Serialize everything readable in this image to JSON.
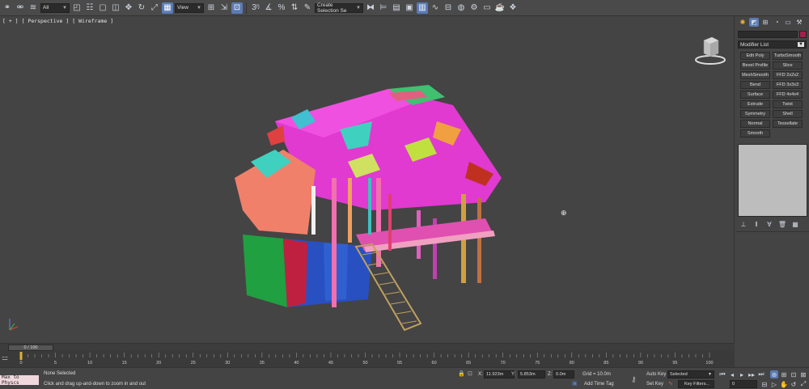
{
  "toolbar": {
    "selection_filter": "All",
    "ref_coord": "View",
    "named_selection": "Create Selection Se",
    "icons": [
      "link-icon",
      "unlink-icon",
      "bind-warp-icon",
      "select-filter",
      "select-object-icon",
      "select-by-name-icon",
      "rect-selection-icon",
      "window-crossing-icon",
      "move-icon",
      "rotate-icon",
      "scale-icon",
      "ref-coord",
      "pivot-icon",
      "mirror-icon",
      "align-icon",
      "snap-icon",
      "angle-snap-icon",
      "percent-snap-icon",
      "spinner-snap-icon",
      "edit-named-sel-icon",
      "named-selection",
      "mirror-icon",
      "align-icon",
      "layer-icon",
      "curve-editor-icon",
      "schematic-icon",
      "material-editor-icon",
      "render-setup-icon",
      "render-frame-icon",
      "render-icon"
    ]
  },
  "viewport": {
    "label_plus": "[ + ]",
    "label_view": "[ Perspective ]",
    "label_shading": "[ Wireframe ]"
  },
  "command_panel": {
    "modifier_list_label": "Modifier List",
    "object_color": "#a0204a",
    "modifiers": [
      "Edit Poly",
      "TurboSmooth",
      "Bevel Profile",
      "Slice",
      "MeshSmooth",
      "FFD 2x2x2",
      "Bend",
      "FFD 3x3x3",
      "Surface",
      "FFD 4x4x4",
      "Extrude",
      "Twist",
      "Symmetry",
      "Shell",
      "Normal",
      "Tessellate",
      "Smooth"
    ]
  },
  "timeline": {
    "frame_counter": "0 / 100",
    "ticks": [
      "0",
      "5",
      "10",
      "15",
      "20",
      "25",
      "30",
      "35",
      "40",
      "45",
      "50",
      "55",
      "60",
      "65",
      "70",
      "75",
      "80",
      "85",
      "90",
      "95",
      "100"
    ]
  },
  "status": {
    "maxscript_text": "Max to Physcs",
    "selection_status": "None Selected",
    "prompt": "Click and drag up-and-down to zoom in and out",
    "x_label": "X:",
    "x_value": "11.923m",
    "y_label": "Y:",
    "y_value": "5.853m",
    "z_label": "Z:",
    "z_value": "0.0m",
    "grid": "Grid = 10.0m",
    "add_time_tag": "Add Time Tag",
    "auto_key": "Auto Key",
    "set_key": "Set Key",
    "key_mode": "Selected",
    "key_filters": "Key Filters...",
    "current_frame": "0"
  }
}
